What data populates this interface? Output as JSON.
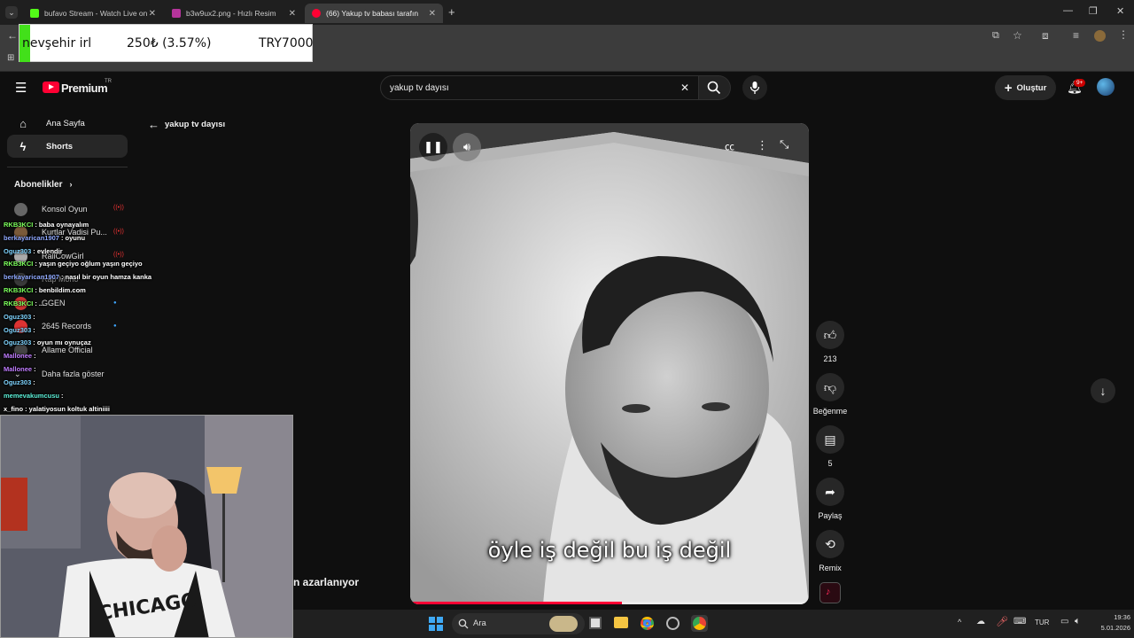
{
  "browser": {
    "tabs": [
      {
        "title": "bufavo Stream - Watch Live on",
        "color": "#53fc18"
      },
      {
        "title": "b3w9ux2.png - Hızlı Resim",
        "color": "#b5349b"
      },
      {
        "title": "(66) Yakup tv babası tarafın",
        "color": "#ff0033"
      }
    ]
  },
  "stream_overlay": {
    "location": "nevşehir irl",
    "change": "250₺ (3.57%)",
    "total": "TRY7000"
  },
  "youtube": {
    "logo_text": "Premium",
    "region": "TR",
    "search_value": "yakup tv dayısı",
    "create_label": "Oluştur",
    "notif_badge": "9+",
    "back_label": "yakup tv dayısı",
    "sidebar": {
      "home": "Ana Sayfa",
      "shorts": "Shorts",
      "subscriptions_header": "Abonelikler",
      "subscriptions": [
        "Konsol Oyun",
        "Kurtlar Vadisi Pu...",
        "RallCowGirl",
        "Rap Mono",
        "GGEN",
        "2645 Records",
        "Allame Official"
      ],
      "show_more": "Daha fazla göster"
    },
    "video": {
      "caption": "öyle iş değil bu iş değil",
      "title_fragment": "n azarlanıyor",
      "progress": 0.53
    },
    "actions": {
      "like_count": "213",
      "dislike_label": "Beğenme",
      "comment_count": "5",
      "share_label": "Paylaş",
      "remix_label": "Remix"
    }
  },
  "chat": [
    {
      "user": "RKB3KCI",
      "color": "#7cff5c",
      "msg": ": baba oynayalım"
    },
    {
      "user": "berkayarican1907",
      "color": "#8fa8ff",
      "msg": ": oyunu"
    },
    {
      "user": "Oguz303",
      "color": "#7fd4ff",
      "msg": ": evlendir"
    },
    {
      "user": "RKB3KCI",
      "color": "#7cff5c",
      "msg": ": yaşın geçiyo oğlum yaşın geçiyo"
    },
    {
      "user": "berkayarican1907",
      "color": "#8fa8ff",
      "msg": ": nasıl bir oyun hamza kanka"
    },
    {
      "user": "RKB3KCI",
      "color": "#7cff5c",
      "msg": ": benbildim.com"
    },
    {
      "user": "RKB3KCI",
      "color": "#7cff5c",
      "msg": ": ..."
    },
    {
      "user": "Oguz303",
      "color": "#7fd4ff",
      "msg": ":"
    },
    {
      "user": "Oguz303",
      "color": "#7fd4ff",
      "msg": ":"
    },
    {
      "user": "Oguz303",
      "color": "#7fd4ff",
      "msg": ": oyun mı oynuçaz"
    },
    {
      "user": "Mallonee",
      "color": "#c07cff",
      "msg": ":"
    },
    {
      "user": "Mallonee",
      "color": "#c07cff",
      "msg": ":"
    },
    {
      "user": "Oguz303",
      "color": "#7fd4ff",
      "msg": ":"
    },
    {
      "user": "memevakumcusu",
      "color": "#5cf0d8",
      "msg": ":"
    },
    {
      "user": "x_fino",
      "color": "#ffffff",
      "msg": ": yalatiyosun koltuk altiniiii"
    }
  ],
  "taskbar": {
    "search": "Ara",
    "lang": "TUR",
    "time": "19:36",
    "date": "5.01.2026"
  }
}
